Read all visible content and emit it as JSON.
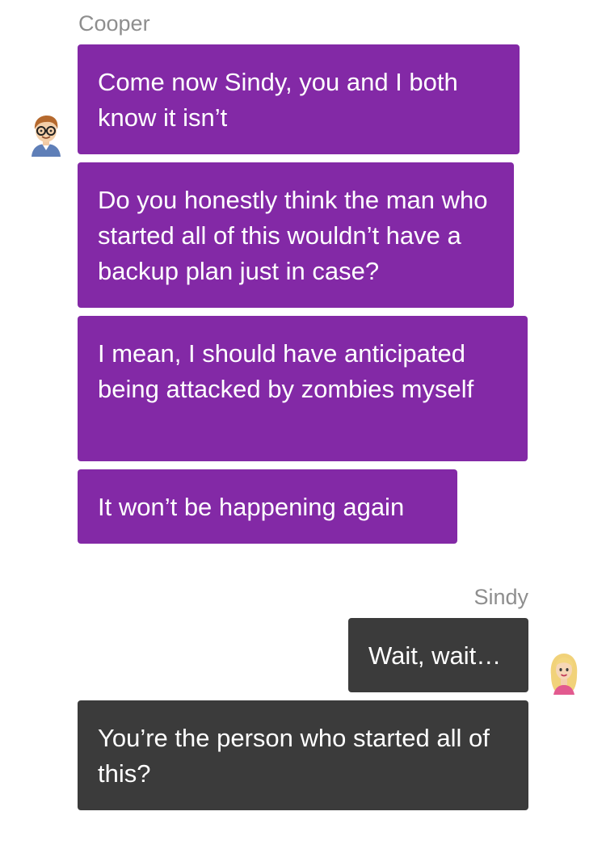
{
  "conversation": {
    "cooper": {
      "name": "Cooper",
      "messages": [
        "Come now Sindy, you and I both know it isn’t",
        "Do you honestly think the man who started all of this wouldn’t have a backup plan just in case?",
        "I mean, I should have anticipated being attacked by zombies myself",
        "It won’t be happening again"
      ]
    },
    "sindy": {
      "name": "Sindy",
      "messages": [
        "Wait, wait…",
        "You’re the person who started all of this?"
      ]
    }
  },
  "colors": {
    "cooper_bubble": "#8329a6",
    "sindy_bubble": "#3b3b3b",
    "sender_name": "#8e8e8e"
  },
  "icons": {
    "cooper_avatar": "cooper-avatar-icon",
    "sindy_avatar": "sindy-avatar-icon"
  }
}
